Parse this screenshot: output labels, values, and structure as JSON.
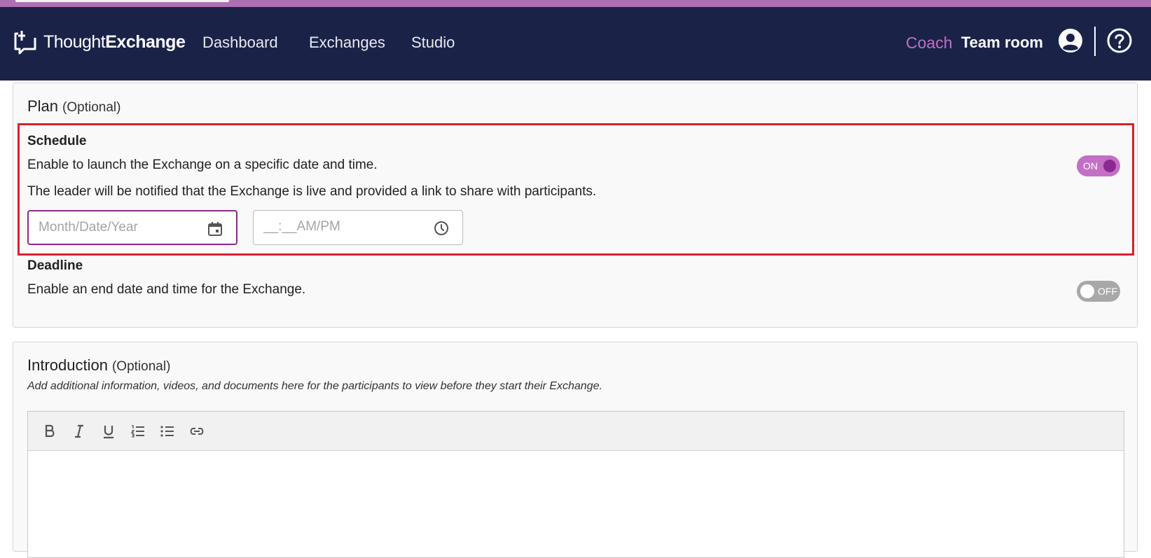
{
  "header": {
    "logo": {
      "part1": "Thought",
      "part2": "Exchange"
    },
    "nav": [
      {
        "label": "Dashboard"
      },
      {
        "label": "Exchanges"
      },
      {
        "label": "Studio"
      }
    ],
    "coach_label": "Coach",
    "team_room_label": "Team room",
    "icons": {
      "user": "account-circle-icon",
      "help": "help-circle-icon"
    }
  },
  "plan": {
    "title": "Plan",
    "optional": "(Optional)",
    "schedule": {
      "label": "Schedule",
      "description": "Enable to launch the Exchange on a specific date and time.",
      "note": "The leader will be notified that the Exchange is live and provided a link to share with participants.",
      "toggle": "ON",
      "date_placeholder": "Month/Date/Year",
      "time_placeholder": "__:__AM/PM"
    },
    "deadline": {
      "label": "Deadline",
      "description": "Enable an end date and time for the Exchange.",
      "toggle": "OFF"
    }
  },
  "introduction": {
    "title": "Introduction",
    "optional": "(Optional)",
    "description": "Add additional information, videos, and documents here for the participants to view before they start their Exchange.",
    "toolbar": [
      "bold-icon",
      "italic-icon",
      "underline-icon",
      "ordered-list-icon",
      "bullet-list-icon",
      "link-icon"
    ]
  },
  "colors": {
    "navbar": "#1a2347",
    "accent": "#c16fc3",
    "highlight": "#d8222c",
    "toggle_on": "#c46fc6",
    "toggle_off": "#a8a8a8"
  }
}
